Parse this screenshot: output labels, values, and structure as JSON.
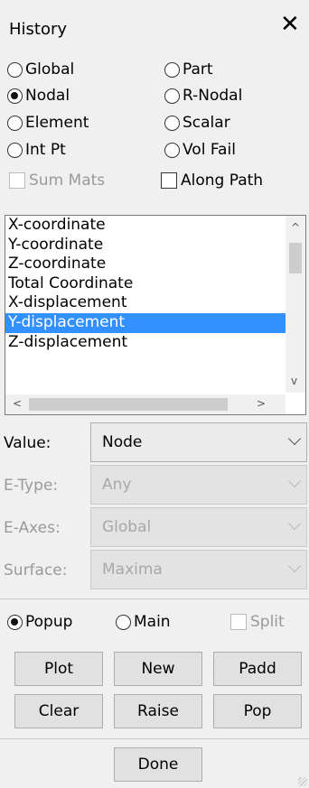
{
  "window": {
    "title": "History",
    "close_glyph": "✕"
  },
  "modes": [
    {
      "label": "Global",
      "selected": false
    },
    {
      "label": "Part",
      "selected": false
    },
    {
      "label": "Nodal",
      "selected": true
    },
    {
      "label": "R-Nodal",
      "selected": false
    },
    {
      "label": "Element",
      "selected": false
    },
    {
      "label": "Scalar",
      "selected": false
    },
    {
      "label": "Int Pt",
      "selected": false
    },
    {
      "label": "Vol Fail",
      "selected": false
    }
  ],
  "checks": {
    "sum_mats": {
      "label": "Sum Mats",
      "enabled": false,
      "checked": false
    },
    "along_path": {
      "label": "Along Path",
      "enabled": true,
      "checked": false
    }
  },
  "list": {
    "items": [
      "X-coordinate",
      "Y-coordinate",
      "Z-coordinate",
      "Total Coordinate",
      "X-displacement",
      "Y-displacement",
      "Z-displacement"
    ],
    "selected_index": 5,
    "arrows": {
      "up": "^",
      "down": "v",
      "left": "<",
      "right": ">"
    }
  },
  "fields": {
    "value": {
      "label": "Value:",
      "selected": "Node"
    },
    "etype": {
      "label": "E-Type:",
      "selected": "Any"
    },
    "eaxes": {
      "label": "E-Axes:",
      "selected": "Global"
    },
    "surface": {
      "label": "Surface:",
      "selected": "Maxima"
    }
  },
  "output": {
    "popup": {
      "label": "Popup",
      "selected": true
    },
    "main": {
      "label": "Main",
      "selected": false
    },
    "split": {
      "label": "Split",
      "enabled": false
    }
  },
  "buttons": {
    "plot": "Plot",
    "new": "New",
    "padd": "Padd",
    "clear": "Clear",
    "raise": "Raise",
    "pop": "Pop",
    "done": "Done"
  }
}
